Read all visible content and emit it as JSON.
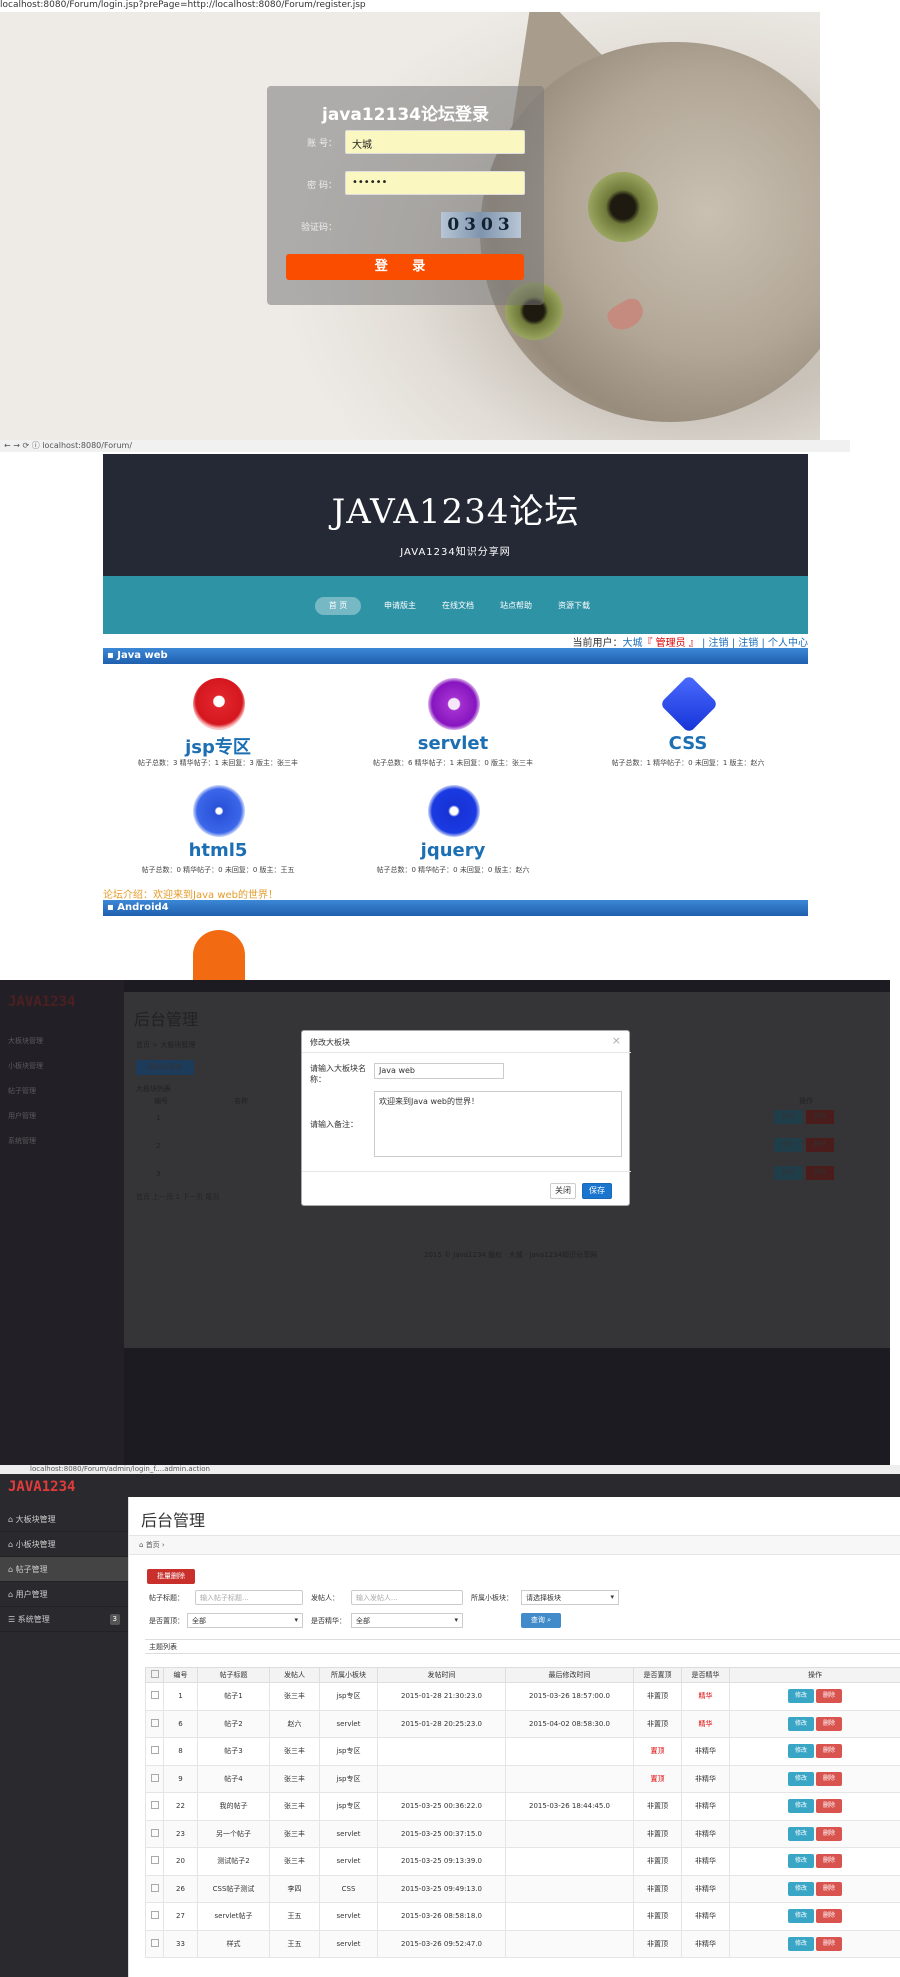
{
  "login": {
    "url": "localhost:8080/Forum/login.jsp?prePage=http://localhost:8080/Forum/register.jsp",
    "title": "java12134论坛登录",
    "account_label": "账 号：",
    "account_value": "大城",
    "password_label": "密 码：",
    "password_value": "••••••",
    "captcha_label": "验证码：",
    "captcha_text": "0303",
    "login_button": "登 录"
  },
  "forum": {
    "url": "localhost:8080/Forum/",
    "logo": "JAVA1234论坛",
    "subtitle": "JAVA1234知识分享网",
    "nav": [
      "首 页",
      "申请版主",
      "在线文档",
      "站点帮助",
      "资源下载"
    ],
    "userline": {
      "prefix": "当前用户：",
      "user": "大城",
      "role": "『 管理员 』",
      "links": " | 注销 | 注销 | 个人中心"
    },
    "section1": "Java web",
    "boards": [
      {
        "name": "jsp专区",
        "stats": "帖子总数：3 精华帖子：1 未回复：3 版主：张三丰",
        "color": "#e0242b"
      },
      {
        "name": "servlet",
        "stats": "帖子总数：6 精华帖子：1 未回复：0 版主：张三丰",
        "color": "#9b22c7"
      },
      {
        "name": "CSS",
        "stats": "帖子总数：1 精华帖子：0 未回复：1 版主：赵六",
        "color": "#1a3ee3"
      },
      {
        "name": "html5",
        "stats": "帖子总数：0 精华帖子：0 未回复：0 版主：王五",
        "color": "#2a52d8"
      },
      {
        "name": "jquery",
        "stats": "帖子总数：0 精华帖子：0 未回复：0 版主：赵六",
        "color": "#1833d6"
      }
    ],
    "intro": "论坛介绍：欢迎来到Java web的世界！",
    "section2": "Android4"
  },
  "modal_admin": {
    "logo": "JAVA1234",
    "page_title": "后台管理",
    "breadcrumb": "首页 > 大板块管理",
    "add_button": "添加大板块",
    "sidebar": [
      "大板块管理",
      "小板块管理",
      "帖子管理",
      "用户管理",
      "系统管理"
    ],
    "list_label": "大板块列表",
    "table_headers": [
      "编号",
      "名称",
      "操作"
    ],
    "rows": [
      "1",
      "2",
      "3"
    ],
    "row_edit": "修改",
    "row_delete": "删除",
    "pagination": "首页 上一页 1 下一页 尾页",
    "footer": "2015 © Java1234 版权 · 大城 · Java1234知识分享网",
    "modal": {
      "title": "修改大板块",
      "name_label": "请输入大板块名称：",
      "name_value": "Java web",
      "remark_label": "请输入备注：",
      "remark_value": "欢迎来到Java web的世界！",
      "close_button": "关闭",
      "save_button": "保存"
    }
  },
  "admin": {
    "url_bar": "localhost:8080/Forum/admin/login_f....admin.action",
    "logo": "JAVA1234",
    "page_title": "后台管理",
    "breadcrumb": "首页",
    "sidebar": [
      {
        "label": "大板块管理"
      },
      {
        "label": "小板块管理"
      },
      {
        "label": "帖子管理"
      },
      {
        "label": "用户管理"
      },
      {
        "label": "系统管理",
        "badge": "3"
      }
    ],
    "bulk_delete": "批量删除",
    "filters": {
      "title_label": "帖子标题：",
      "title_placeholder": "输入帖子标题...",
      "author_label": "发帖人：",
      "author_placeholder": "输入发帖人...",
      "section_label": "所属小板块：",
      "section_value": "请选择板块",
      "top_label": "是否置顶：",
      "top_value": "全部",
      "good_label": "是否精华：",
      "good_value": "全部",
      "query_button": "查询"
    },
    "list_label": "主题列表",
    "headers": [
      "编号",
      "帖子标题",
      "发帖人",
      "所属小板块",
      "发帖时间",
      "最后修改时间",
      "是否置顶",
      "是否精华",
      "操作"
    ],
    "rows": [
      {
        "id": "1",
        "title": "帖子1",
        "author": "张三丰",
        "section": "jsp专区",
        "posted": "2015-01-28 21:30:23.0",
        "modified": "2015-03-26 18:57:00.0",
        "top": "非置顶",
        "good": "精华"
      },
      {
        "id": "6",
        "title": "帖子2",
        "author": "赵六",
        "section": "servlet",
        "posted": "2015-01-28 20:25:23.0",
        "modified": "2015-04-02 08:58:30.0",
        "top": "非置顶",
        "good": "精华"
      },
      {
        "id": "8",
        "title": "帖子3",
        "author": "张三丰",
        "section": "jsp专区",
        "posted": "",
        "modified": "",
        "top": "置顶",
        "good": "非精华"
      },
      {
        "id": "9",
        "title": "帖子4",
        "author": "张三丰",
        "section": "jsp专区",
        "posted": "",
        "modified": "",
        "top": "置顶",
        "good": "非精华"
      },
      {
        "id": "22",
        "title": "我的帖子",
        "author": "张三丰",
        "section": "jsp专区",
        "posted": "2015-03-25 00:36:22.0",
        "modified": "2015-03-26 18:44:45.0",
        "top": "非置顶",
        "good": "非精华"
      },
      {
        "id": "23",
        "title": "另一个帖子",
        "author": "张三丰",
        "section": "servlet",
        "posted": "2015-03-25 00:37:15.0",
        "modified": "",
        "top": "非置顶",
        "good": "非精华"
      },
      {
        "id": "20",
        "title": "测试帖子2",
        "author": "张三丰",
        "section": "servlet",
        "posted": "2015-03-25 09:13:39.0",
        "modified": "",
        "top": "非置顶",
        "good": "非精华"
      },
      {
        "id": "26",
        "title": "CSS帖子测试",
        "author": "李四",
        "section": "CSS",
        "posted": "2015-03-25 09:49:13.0",
        "modified": "",
        "top": "非置顶",
        "good": "非精华"
      },
      {
        "id": "27",
        "title": "servlet帖子",
        "author": "王五",
        "section": "servlet",
        "posted": "2015-03-26 08:58:18.0",
        "modified": "",
        "top": "非置顶",
        "good": "非精华"
      },
      {
        "id": "33",
        "title": "样式",
        "author": "王五",
        "section": "servlet",
        "posted": "2015-03-26 09:52:47.0",
        "modified": "",
        "top": "非置顶",
        "good": "非精华"
      }
    ],
    "edit_label": "修改",
    "delete_label": "删除"
  }
}
